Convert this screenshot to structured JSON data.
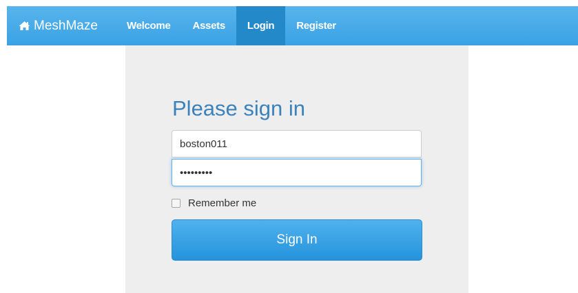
{
  "navbar": {
    "brand_label": "MeshMaze",
    "brand_icon": "home-icon",
    "items": [
      {
        "label": "Welcome",
        "active": false
      },
      {
        "label": "Assets",
        "active": false
      },
      {
        "label": "Login",
        "active": true
      },
      {
        "label": "Register",
        "active": false
      }
    ],
    "color": "#3aa2e4",
    "active_color": "#2489c8"
  },
  "login": {
    "heading": "Please sign in",
    "username_value": "boston011",
    "password_value": "•••••••••",
    "remember_label": "Remember me",
    "remember_checked": false,
    "submit_label": "Sign In"
  },
  "colors": {
    "heading": "#3b82bd",
    "panel_background": "#eeeeee",
    "button": "#2593dc"
  }
}
